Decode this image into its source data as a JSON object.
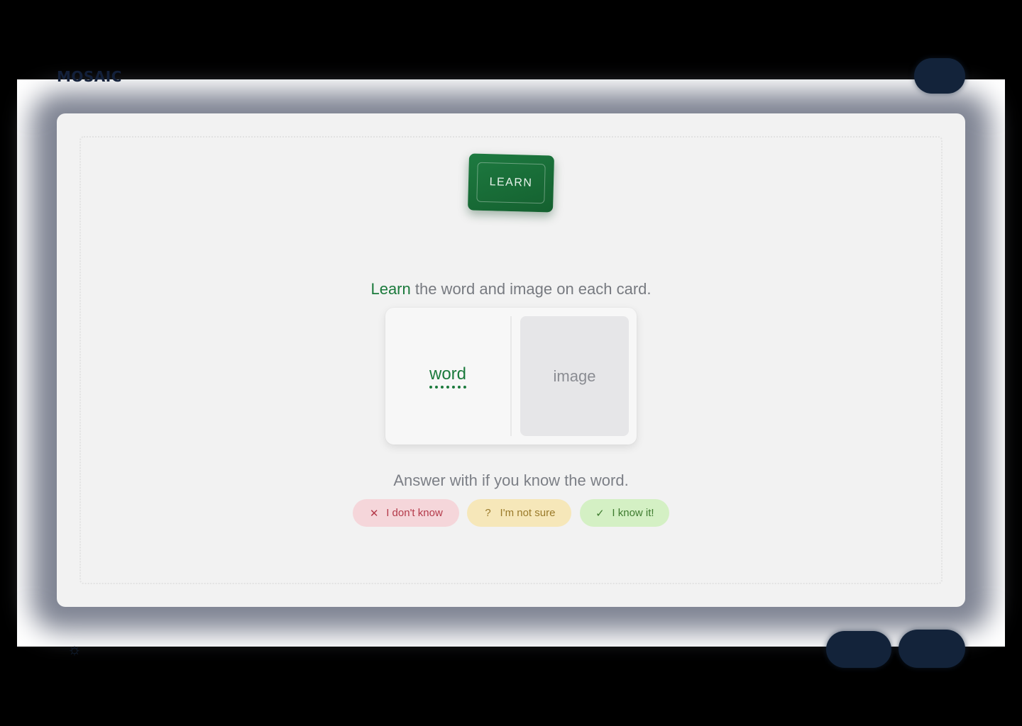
{
  "app": {
    "logo_text": "MOSAIC"
  },
  "mode_badge": {
    "label": "LEARN"
  },
  "instruction": {
    "accent": "Learn",
    "rest": " the word and image on each card."
  },
  "card": {
    "word": "word",
    "image_label": "image"
  },
  "answer_prompt": "Answer with if you know the word.",
  "answers": [
    {
      "label": "I don't know",
      "icon": "x-icon",
      "glyph": "✕",
      "color": "#b43a4a",
      "bg": "#f5d6da"
    },
    {
      "label": "I'm not sure",
      "icon": "question-icon",
      "glyph": "?",
      "color": "#9a7a2a",
      "bg": "#f6e7b9"
    },
    {
      "label": "I know it!",
      "icon": "check-icon",
      "glyph": "✓",
      "color": "#3e7b2f",
      "bg": "#d4f0c4"
    }
  ],
  "colors": {
    "accent_green": "#1b7a3c",
    "dark_navy": "#13233a",
    "panel_bg": "#f2f2f2"
  }
}
